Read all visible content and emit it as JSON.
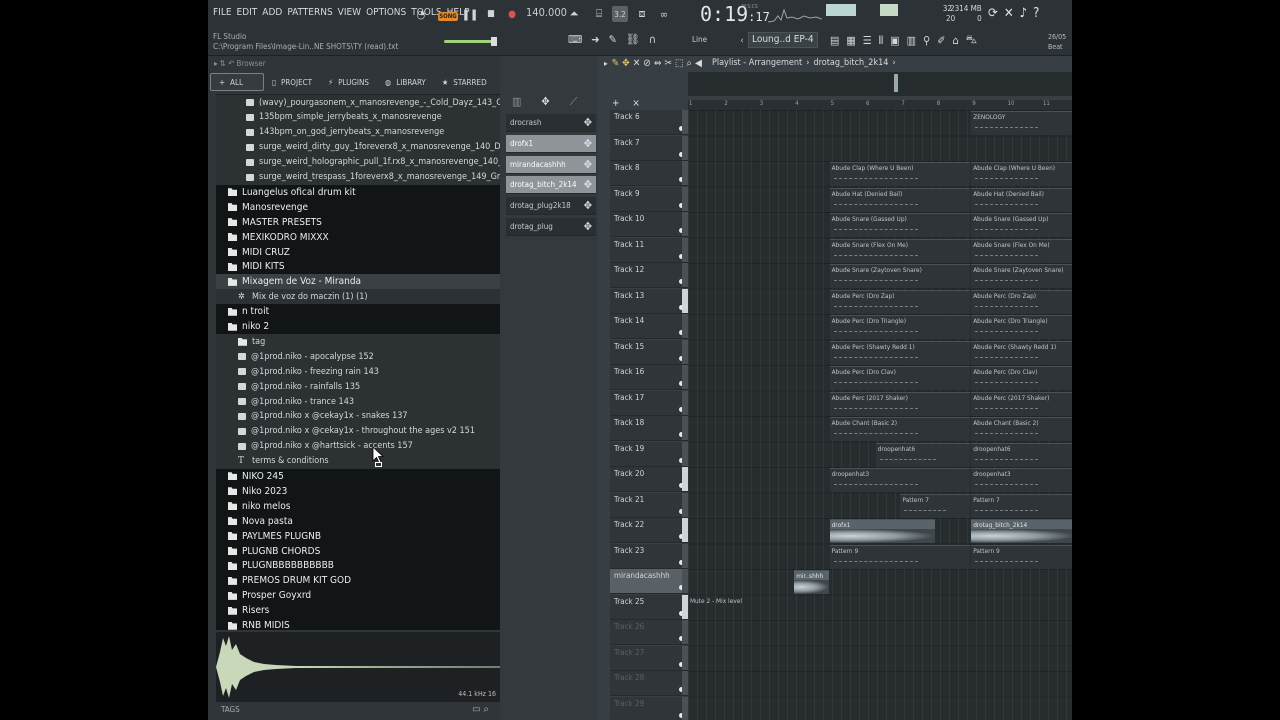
{
  "menu": [
    "FILE",
    "EDIT",
    "ADD",
    "PATTERNS",
    "VIEW",
    "OPTIONS",
    "TOOLS",
    "HELP"
  ],
  "project": {
    "app_name": "FL Studio",
    "path": "C:\\Program Files\\Image-Lin..NE SHOTS\\TY (read).txt"
  },
  "transport": {
    "mode_badge": "SONG",
    "tempo": "140.000",
    "time_main": "0:19",
    "time_sub": "17",
    "time_units": "M:S:CS"
  },
  "cpu": {
    "value": "32",
    "poly": "20"
  },
  "memory": {
    "mb": "2314 MB",
    "extra": "0"
  },
  "snap": {
    "label": "Line"
  },
  "pattern_selector": {
    "value": "Loung..d EP-4"
  },
  "beat": {
    "date": "26/05",
    "label": "Beat"
  },
  "browser": {
    "title": "Browser",
    "tabs": [
      "ALL",
      "PROJECT",
      "PLUGINS",
      "LIBRARY",
      "STARRED"
    ],
    "items": [
      {
        "t": "file",
        "icon": "audio",
        "indent": 30,
        "label": "(wavy)_pourgasonem_x_manosrevenge_-_Cold_Dayz_143_Gmaj"
      },
      {
        "t": "file",
        "icon": "audio",
        "indent": 30,
        "label": "135bpm_simple_jerrybeats_x_manosrevenge"
      },
      {
        "t": "file",
        "icon": "audio",
        "indent": 30,
        "label": "143bpm_on_god_jerrybeats_x_manosrevenge"
      },
      {
        "t": "file",
        "icon": "audio",
        "indent": 30,
        "label": "surge_weird_dirty_guy_1foreverx8_x_manosrevenge_140_Dm"
      },
      {
        "t": "file",
        "icon": "audio",
        "indent": 30,
        "label": "surge_weird_holographic_pull_1f.rx8_x_manosrevenge_140_AsharpM"
      },
      {
        "t": "file",
        "icon": "audio",
        "indent": 30,
        "label": "surge_weird_trespass_1foreverx8_x_manosrevenge_149_Gm"
      },
      {
        "t": "folder",
        "icon": "folder",
        "indent": 12,
        "label": "Luangelus ofical drum kit"
      },
      {
        "t": "folder",
        "icon": "folder",
        "indent": 12,
        "label": "Manosrevenge"
      },
      {
        "t": "folder",
        "icon": "folder",
        "indent": 12,
        "label": "MASTER PRESETS"
      },
      {
        "t": "folder",
        "icon": "folder",
        "indent": 12,
        "label": "MEXIKODRO MIXXX"
      },
      {
        "t": "folder",
        "icon": "folder",
        "indent": 12,
        "label": "MIDI CRUZ"
      },
      {
        "t": "folder",
        "icon": "folder",
        "indent": 12,
        "label": "MIDI KITS"
      },
      {
        "t": "folder",
        "icon": "folder",
        "indent": 12,
        "label": "Mixagem de Voz - Miranda",
        "sel": true
      },
      {
        "t": "file",
        "icon": "gear",
        "indent": 22,
        "label": "Mix de voz do maczin (1) (1)"
      },
      {
        "t": "folder",
        "icon": "folder",
        "indent": 12,
        "label": "n troit"
      },
      {
        "t": "folder",
        "icon": "folder",
        "indent": 12,
        "label": "niko 2"
      },
      {
        "t": "file",
        "icon": "folder",
        "indent": 22,
        "label": "tag"
      },
      {
        "t": "file",
        "icon": "audio",
        "indent": 22,
        "label": "@1prod.niko - apocalypse 152"
      },
      {
        "t": "file",
        "icon": "audio",
        "indent": 22,
        "label": "@1prod.niko - freezing rain 143"
      },
      {
        "t": "file",
        "icon": "audio",
        "indent": 22,
        "label": "@1prod.niko - rainfalls 135"
      },
      {
        "t": "file",
        "icon": "audio",
        "indent": 22,
        "label": "@1prod.niko - trance 143"
      },
      {
        "t": "file",
        "icon": "audio",
        "indent": 22,
        "label": "@1prod.niko x @cekay1x - snakes 137"
      },
      {
        "t": "file",
        "icon": "audio",
        "indent": 22,
        "label": "@1prod.niko x @cekay1x - throughout the ages v2 151"
      },
      {
        "t": "file",
        "icon": "audio",
        "indent": 22,
        "label": "@1prod.niko x @harttsick - accents 157"
      },
      {
        "t": "file",
        "icon": "text",
        "indent": 22,
        "label": "terms & conditions"
      },
      {
        "t": "folder",
        "icon": "folder",
        "indent": 12,
        "label": "NIKO 245"
      },
      {
        "t": "folder",
        "icon": "folder",
        "indent": 12,
        "label": "Niko 2023"
      },
      {
        "t": "folder",
        "icon": "folder",
        "indent": 12,
        "label": "niko melos"
      },
      {
        "t": "folder",
        "icon": "folder",
        "indent": 12,
        "label": "Nova pasta"
      },
      {
        "t": "folder",
        "icon": "folder",
        "indent": 12,
        "label": "PAYLMES PLUGNB"
      },
      {
        "t": "folder",
        "icon": "folder",
        "indent": 12,
        "label": "PLUGNB CHORDS"
      },
      {
        "t": "folder",
        "icon": "folder",
        "indent": 12,
        "label": "PLUGNBBBBBBBBBB"
      },
      {
        "t": "folder",
        "icon": "folder",
        "indent": 12,
        "label": "PREMOS DRUM KIT GOD"
      },
      {
        "t": "folder",
        "icon": "folder",
        "indent": 12,
        "label": "Prosper Goyxrd"
      },
      {
        "t": "folder",
        "icon": "folder",
        "indent": 12,
        "label": "Risers"
      },
      {
        "t": "folder",
        "icon": "folder",
        "indent": 12,
        "label": "RNB MIDIS"
      }
    ],
    "waveform_info": "44.1 kHz 16",
    "tags_label": "TAGS"
  },
  "picker": {
    "items": [
      {
        "label": "drocrash",
        "sel": false
      },
      {
        "label": "drofx1",
        "sel": true
      },
      {
        "label": "mirandacashhh",
        "sel": true
      },
      {
        "label": "drotag_bitch_2k14",
        "sel": true
      },
      {
        "label": "drotag_plug2k18",
        "sel": false
      },
      {
        "label": "drotag_plug",
        "sel": false
      }
    ]
  },
  "playlist": {
    "title": "Playlist - Arrangement",
    "pattern": "drotag_bitch_2k14",
    "bars": [
      "1",
      "2",
      "3",
      "4",
      "5",
      "6",
      "7",
      "8",
      "9",
      "10",
      "11"
    ],
    "tracks": [
      {
        "name": "Track 6"
      },
      {
        "name": "Track 7"
      },
      {
        "name": "Track 8"
      },
      {
        "name": "Track 9"
      },
      {
        "name": "Track 10"
      },
      {
        "name": "Track 11"
      },
      {
        "name": "Track 12"
      },
      {
        "name": "Track 13"
      },
      {
        "name": "Track 14"
      },
      {
        "name": "Track 15"
      },
      {
        "name": "Track 16"
      },
      {
        "name": "Track 17"
      },
      {
        "name": "Track 18"
      },
      {
        "name": "Track 19"
      },
      {
        "name": "Track 20"
      },
      {
        "name": "Track 21"
      },
      {
        "name": "Track 22"
      },
      {
        "name": "Track 23"
      },
      {
        "name": "mirandacashhh"
      },
      {
        "name": "Track 25"
      },
      {
        "name": "Track 26",
        "dim": true
      },
      {
        "name": "Track 27",
        "dim": true
      },
      {
        "name": "Track 28",
        "dim": true
      },
      {
        "name": "Track 29",
        "dim": true
      }
    ],
    "clips": [
      {
        "row": 0,
        "bar": 9,
        "len": 3,
        "label": "ZENOLOGY"
      },
      {
        "row": 2,
        "bar": 5,
        "len": 4,
        "label": "Abude Clap (Where U Been)"
      },
      {
        "row": 2,
        "bar": 9,
        "len": 3,
        "label": "Abude Clap (Where U Been)"
      },
      {
        "row": 3,
        "bar": 5,
        "len": 4,
        "label": "Abude Hat (Denied Bail)"
      },
      {
        "row": 3,
        "bar": 9,
        "len": 3,
        "label": "Abude Hat (Denied Bail)"
      },
      {
        "row": 4,
        "bar": 5,
        "len": 4,
        "label": "Abude Snare (Gassed Up)"
      },
      {
        "row": 4,
        "bar": 9,
        "len": 3,
        "label": "Abude Snare (Gassed Up)"
      },
      {
        "row": 5,
        "bar": 5,
        "len": 4,
        "label": "Abude Snare (Flex On Me)"
      },
      {
        "row": 5,
        "bar": 9,
        "len": 3,
        "label": "Abude Snare (Flex On Me)"
      },
      {
        "row": 6,
        "bar": 5,
        "len": 4,
        "label": "Abude Snare (Zaytoven Snare)"
      },
      {
        "row": 6,
        "bar": 9,
        "len": 3,
        "label": "Abude Snare (Zaytoven Snare)"
      },
      {
        "row": 7,
        "bar": 5,
        "len": 4,
        "label": "Abude Perc (Dro Zap)"
      },
      {
        "row": 7,
        "bar": 9,
        "len": 3,
        "label": "Abude Perc (Dro Zap)"
      },
      {
        "row": 8,
        "bar": 5,
        "len": 4,
        "label": "Abude Perc (Dro Triangle)"
      },
      {
        "row": 8,
        "bar": 9,
        "len": 3,
        "label": "Abude Perc (Dro Triangle)"
      },
      {
        "row": 9,
        "bar": 5,
        "len": 4,
        "label": "Abude Perc (Shawty Redd 1)"
      },
      {
        "row": 9,
        "bar": 9,
        "len": 3,
        "label": "Abude Perc (Shawty Redd 1)"
      },
      {
        "row": 10,
        "bar": 5,
        "len": 4,
        "label": "Abude Perc (Dro Clav)"
      },
      {
        "row": 10,
        "bar": 9,
        "len": 3,
        "label": "Abude Perc (Dro Clav)"
      },
      {
        "row": 11,
        "bar": 5,
        "len": 4,
        "label": "Abude Perc (2017 Shaker)"
      },
      {
        "row": 11,
        "bar": 9,
        "len": 3,
        "label": "Abude Perc (2017 Shaker)"
      },
      {
        "row": 12,
        "bar": 5,
        "len": 4,
        "label": "Abude Chant (Basic 2)"
      },
      {
        "row": 12,
        "bar": 9,
        "len": 3,
        "label": "Abude Chant (Basic 2)"
      },
      {
        "row": 13,
        "bar": 6.3,
        "len": 2.7,
        "label": "droopenhat6"
      },
      {
        "row": 13,
        "bar": 9,
        "len": 3,
        "label": "droopenhat6"
      },
      {
        "row": 14,
        "bar": 5,
        "len": 4,
        "label": "droopenhat3"
      },
      {
        "row": 14,
        "bar": 9,
        "len": 3,
        "label": "droopenhat3"
      },
      {
        "row": 15,
        "bar": 7,
        "len": 2,
        "label": "Pattern 7"
      },
      {
        "row": 15,
        "bar": 9,
        "len": 3,
        "label": "Pattern 7"
      },
      {
        "row": 16,
        "bar": 5,
        "len": 3,
        "label": "drofx1",
        "audio": true
      },
      {
        "row": 16,
        "bar": 9,
        "len": 3,
        "label": "drotag_bitch_2k14",
        "audio": true
      },
      {
        "row": 17,
        "bar": 5,
        "len": 4,
        "label": "Pattern 9"
      },
      {
        "row": 17,
        "bar": 9,
        "len": 3,
        "label": "Pattern 9"
      },
      {
        "row": 18,
        "bar": 4,
        "len": 1,
        "label": "mir..shhh",
        "audio": true
      },
      {
        "row": 19,
        "bar": 1,
        "len": 11,
        "label": "Mute 2 - Mix level"
      }
    ]
  }
}
